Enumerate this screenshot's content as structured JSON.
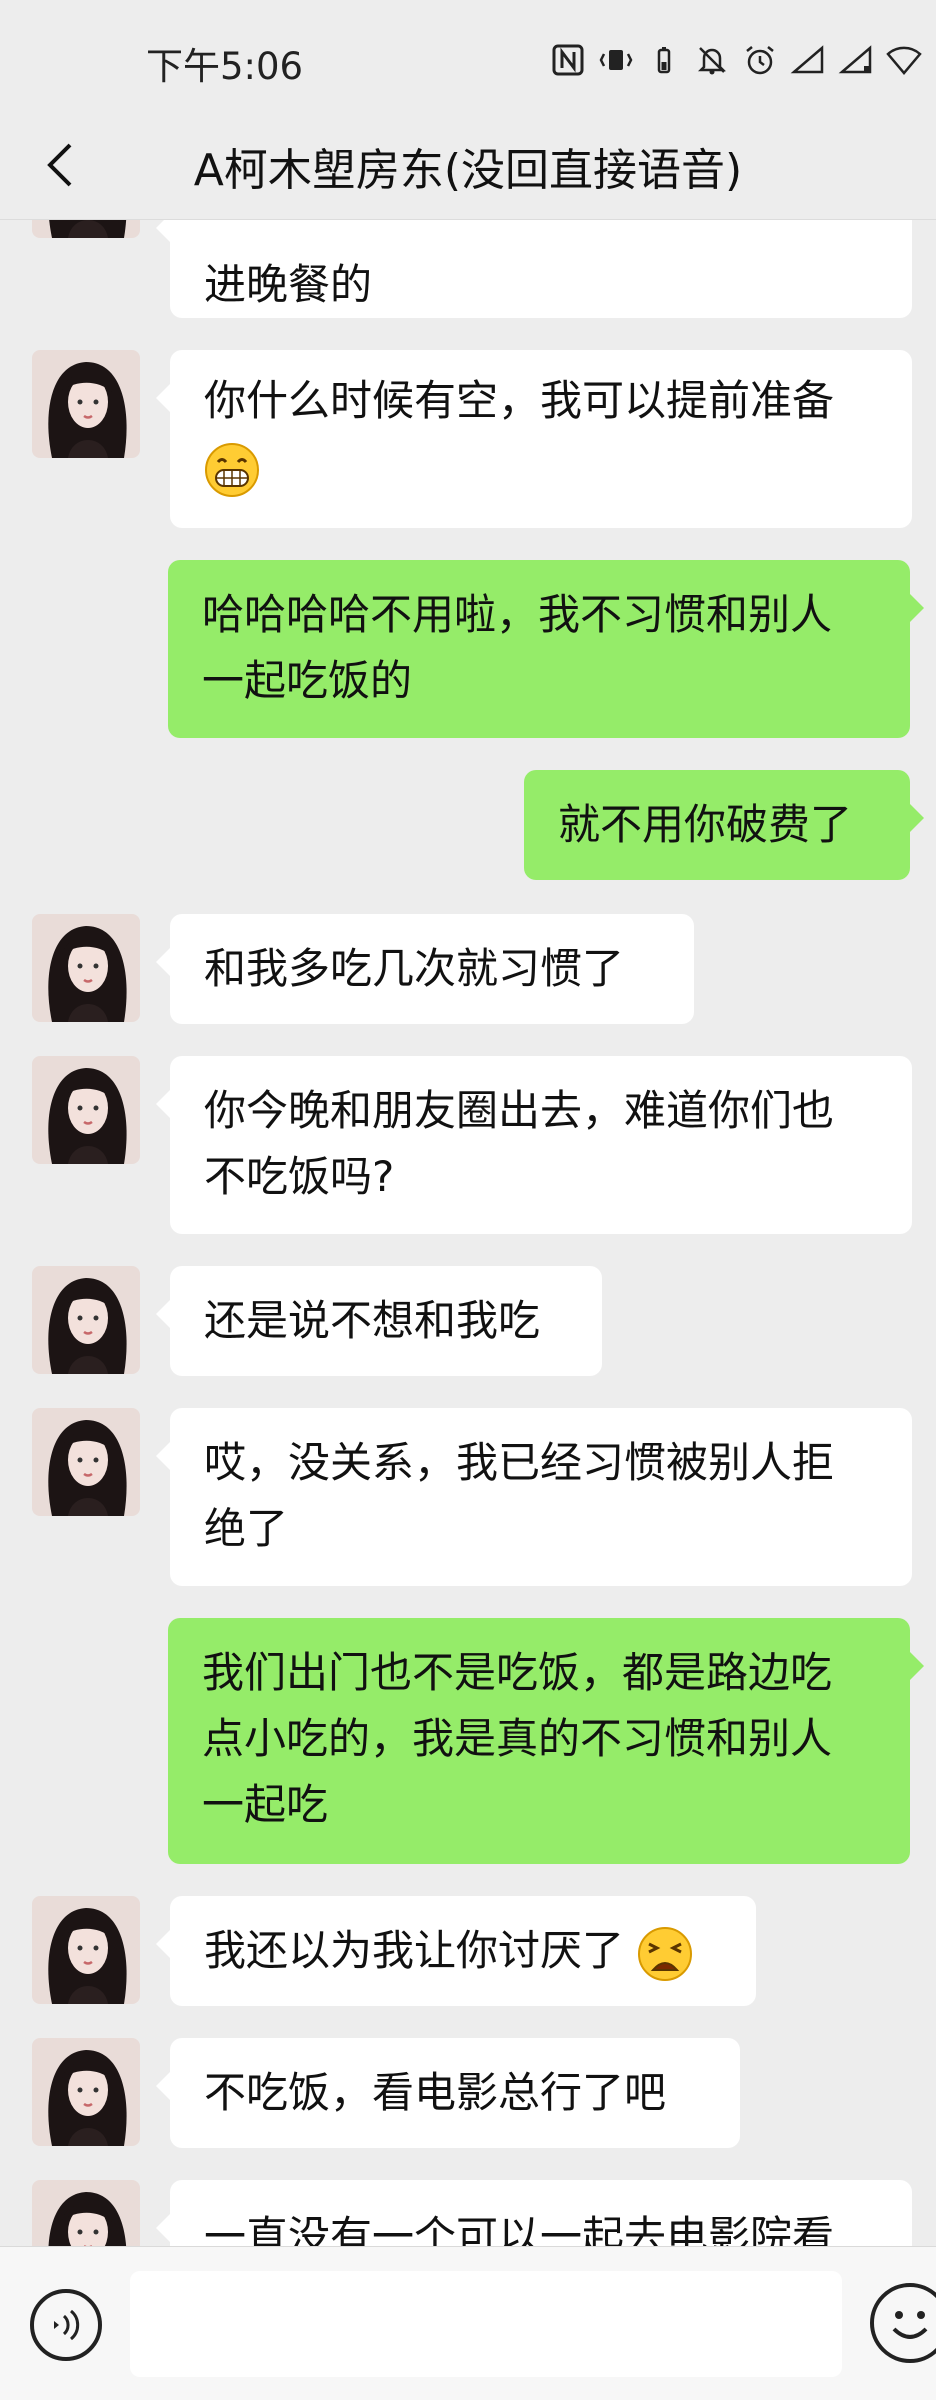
{
  "status_bar": {
    "time": "下午5:06",
    "icons": [
      "nfc-icon",
      "vibrate-icon",
      "battery-small-icon",
      "bell-off-icon",
      "alarm-icon",
      "signal-1-icon",
      "signal-2-icon",
      "wifi-icon"
    ]
  },
  "header": {
    "title": "A柯木塱房东(没回直接语音)",
    "back_icon": "chevron-left-icon"
  },
  "messages": [
    {
      "side": "in",
      "lines": [
        "进晚餐的"
      ]
    },
    {
      "side": "in",
      "lines": [
        "你什么时候有空，我可以提前准备"
      ],
      "emoji": "grinning-face"
    },
    {
      "side": "out",
      "lines": [
        "哈哈哈哈不用啦，我不习惯和别人",
        "一起吃饭的"
      ]
    },
    {
      "side": "out",
      "lines": [
        "就不用你破费了"
      ]
    },
    {
      "side": "in",
      "lines": [
        "和我多吃几次就习惯了"
      ]
    },
    {
      "side": "in",
      "lines": [
        "你今晚和朋友圈出去，难道你们也",
        "不吃饭吗?"
      ]
    },
    {
      "side": "in",
      "lines": [
        "还是说不想和我吃"
      ]
    },
    {
      "side": "in",
      "lines": [
        "哎，没关系，我已经习惯被别人拒",
        "绝了"
      ]
    },
    {
      "side": "out",
      "lines": [
        "我们出门也不是吃饭，都是路边吃",
        "点小吃的，我是真的不习惯和别人",
        "一起吃"
      ]
    },
    {
      "side": "in",
      "lines": [
        "我还以为我让你讨厌了"
      ],
      "emoji": "tired-face"
    },
    {
      "side": "in",
      "lines": [
        "不吃饭，看电影总行了吧"
      ]
    },
    {
      "side": "in",
      "lines": [
        "一直没有一个可以一起去电影院看"
      ]
    }
  ],
  "bottom_bar": {
    "input_value": "",
    "input_placeholder": "",
    "voice_icon": "voice-icon",
    "emoji_icon": "emoji-icon"
  },
  "colors": {
    "background": "#ededed",
    "bubble_in": "#ffffff",
    "bubble_out": "#95ec69"
  }
}
